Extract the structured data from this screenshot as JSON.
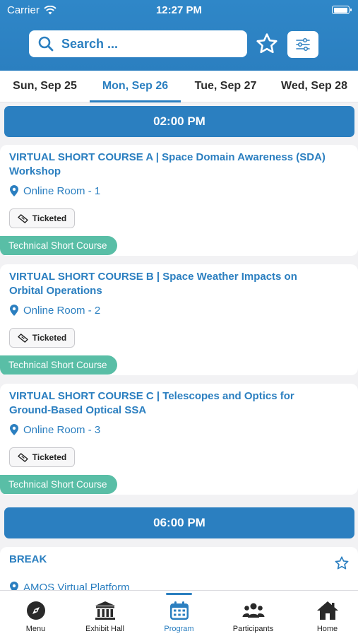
{
  "status_bar": {
    "carrier": "Carrier",
    "time": "12:27 PM"
  },
  "search": {
    "placeholder": "Search ..."
  },
  "date_tabs": [
    {
      "label": "Sun, Sep 25",
      "active": false
    },
    {
      "label": "Mon, Sep 26",
      "active": true
    },
    {
      "label": "Tue, Sep 27",
      "active": false
    },
    {
      "label": "Wed, Sep 28",
      "active": false
    }
  ],
  "time_slots": [
    "02:00 PM",
    "06:00 PM"
  ],
  "sessions": [
    {
      "title": "VIRTUAL SHORT COURSE A | Space Domain Awareness (SDA) Workshop",
      "room": "Online Room - 1",
      "badge": "Ticketed",
      "track": "Technical Short Course"
    },
    {
      "title": "VIRTUAL SHORT COURSE B | Space Weather Impacts on Orbital Operations",
      "room": "Online Room - 2",
      "badge": "Ticketed",
      "track": "Technical Short Course"
    },
    {
      "title": "VIRTUAL SHORT COURSE C | Telescopes and Optics for Ground-Based Optical SSA",
      "room": "Online Room - 3",
      "badge": "Ticketed",
      "track": "Technical Short Course"
    },
    {
      "title": "BREAK",
      "room": "AMOS Virtual Platform"
    }
  ],
  "bottom_nav": [
    {
      "label": "Menu",
      "icon": "compass-icon",
      "active": false
    },
    {
      "label": "Exhibit Hall",
      "icon": "building-icon",
      "active": false
    },
    {
      "label": "Program",
      "icon": "calendar-icon",
      "active": true
    },
    {
      "label": "Participants",
      "icon": "people-icon",
      "active": false
    },
    {
      "label": "Home",
      "icon": "home-icon",
      "active": false
    }
  ],
  "colors": {
    "primary": "#2b7fc0",
    "track": "#59bea6"
  }
}
